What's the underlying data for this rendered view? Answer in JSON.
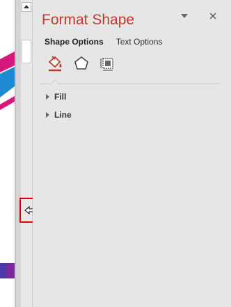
{
  "pane": {
    "title": "Format Shape",
    "tabs": [
      {
        "label": "Shape Options",
        "active": true
      },
      {
        "label": "Text Options",
        "active": false
      }
    ],
    "icons": [
      {
        "name": "fill-line-icon",
        "selected": true
      },
      {
        "name": "effects-icon",
        "selected": false
      },
      {
        "name": "size-properties-icon",
        "selected": false
      }
    ],
    "sections": [
      {
        "label": "Fill",
        "expanded": false
      },
      {
        "label": "Line",
        "expanded": false
      }
    ]
  },
  "colors": {
    "title": "#c0392b",
    "highlight": "#e00000",
    "pane_bg": "#e6e6e6"
  }
}
